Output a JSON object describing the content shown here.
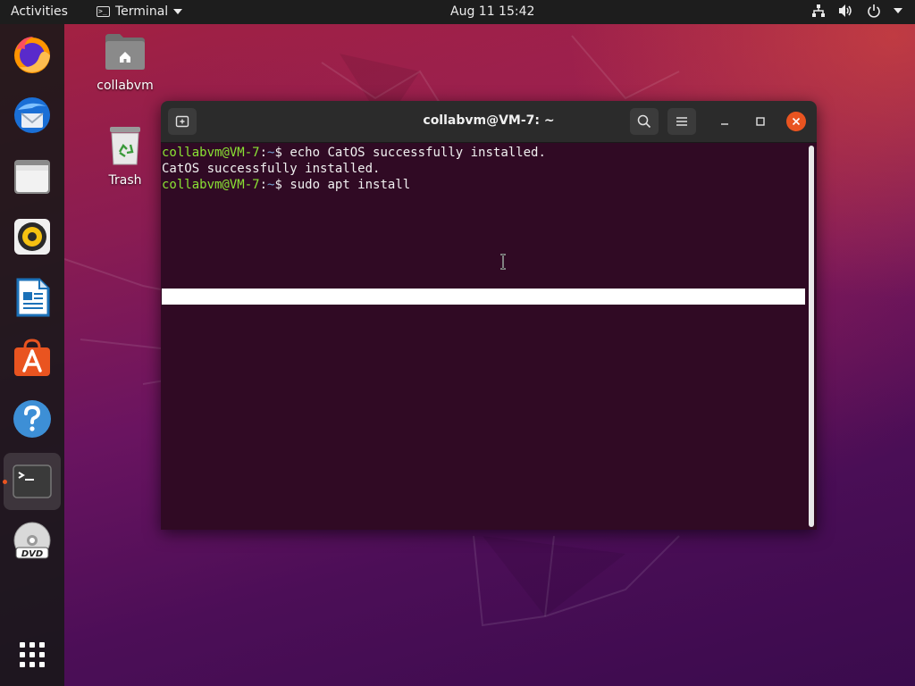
{
  "topbar": {
    "activities": "Activities",
    "app_name": "Terminal",
    "clock": "Aug 11  15:42"
  },
  "dock": {
    "items": [
      {
        "name": "firefox",
        "icon": "firefox-icon"
      },
      {
        "name": "thunderbird",
        "icon": "thunderbird-icon"
      },
      {
        "name": "files",
        "icon": "files-icon"
      },
      {
        "name": "rhythmbox",
        "icon": "rhythmbox-icon"
      },
      {
        "name": "libreoffice-writer",
        "icon": "writer-icon"
      },
      {
        "name": "ubuntu-software",
        "icon": "software-store-icon"
      },
      {
        "name": "help",
        "icon": "help-icon"
      },
      {
        "name": "terminal",
        "icon": "terminal-icon",
        "running": true
      },
      {
        "name": "dvd",
        "icon": "dvd-icon"
      },
      {
        "name": "show-applications",
        "icon": "app-grid-icon"
      }
    ],
    "dvd_label": "DVD"
  },
  "desktop": {
    "icons": [
      {
        "label": "collabvm",
        "icon": "home-folder-icon"
      },
      {
        "label": "Trash",
        "icon": "trash-icon"
      }
    ]
  },
  "terminal": {
    "title": "collabvm@VM-7: ~",
    "lines": [
      {
        "user": "collabvm@VM-7",
        "sep": ":",
        "path": "~",
        "symbol": "$",
        "command": " echo CatOS successfully installed."
      },
      {
        "output": "CatOS successfully installed."
      },
      {
        "user": "collabvm@VM-7",
        "sep": ":",
        "path": "~",
        "symbol": "$",
        "command": " sudo apt install"
      }
    ]
  },
  "colors": {
    "accent": "#e95420",
    "terminal_bg": "#300a24",
    "prompt_user": "#8ae234",
    "prompt_path": "#729fcf"
  }
}
